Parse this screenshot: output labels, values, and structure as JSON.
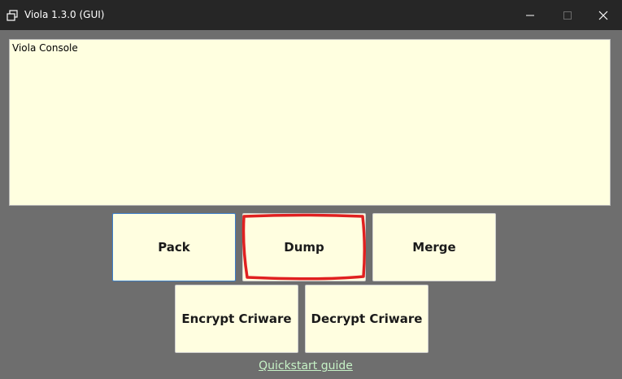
{
  "window": {
    "title": "Viola 1.3.0 (GUI)",
    "controls": {
      "minimize": "minimize-icon",
      "maximize": "maximize-icon",
      "close": "close-icon"
    }
  },
  "console": {
    "text": "Viola Console"
  },
  "buttons": {
    "pack": "Pack",
    "dump": "Dump",
    "merge": "Merge",
    "encrypt": "Encrypt Criware",
    "decrypt": "Decrypt Criware"
  },
  "links": {
    "quickstart": "Quickstart guide"
  },
  "colors": {
    "titlebar": "#262626",
    "background": "#6e6e6e",
    "console_background": "#ffffe0",
    "button_background": "#fffee0",
    "focus_border": "#3d7ec9",
    "annotation_highlight": "#e02020",
    "link": "#c6f2c6"
  }
}
